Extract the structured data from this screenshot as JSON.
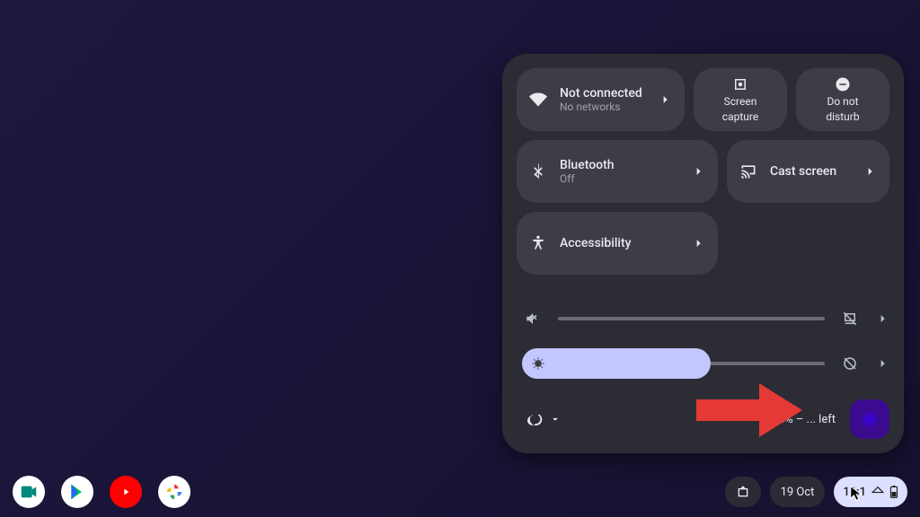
{
  "panel": {
    "wifi": {
      "title": "Not connected",
      "sub": "No networks"
    },
    "screencap": {
      "line1": "Screen",
      "line2": "capture"
    },
    "dnd": {
      "line1": "Do not",
      "line2": "disturb"
    },
    "bluetooth": {
      "title": "Bluetooth",
      "sub": "Off"
    },
    "cast": {
      "title": "Cast screen"
    },
    "accessibility": {
      "title": "Accessibility"
    },
    "volume": {
      "percent": 0,
      "muted": true
    },
    "brightness": {
      "percent": 50
    },
    "battery": {
      "text": "54% – ... left"
    }
  },
  "shelf": {
    "date": "19 Oct",
    "clock": "11:1"
  }
}
